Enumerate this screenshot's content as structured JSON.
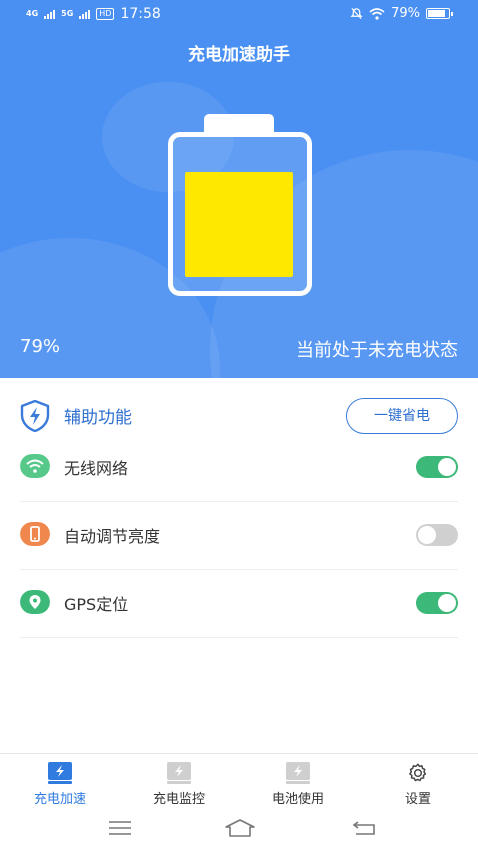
{
  "status_bar": {
    "net1": "4G",
    "net2": "5G",
    "hd": "HD",
    "time": "17:58",
    "battery_pct": "79%"
  },
  "header": {
    "title": "充电加速助手"
  },
  "battery": {
    "percent_label": "79%",
    "level": 0.79,
    "state": "当前处于未充电状态",
    "fill_color": "#ffe800"
  },
  "section": {
    "title": "辅助功能",
    "save_button": "一键省电"
  },
  "features": [
    {
      "label": "无线网络",
      "icon": "wifi-icon",
      "color": "#56c98a",
      "on": true
    },
    {
      "label": "自动调节亮度",
      "icon": "phone-icon",
      "color": "#f0874c",
      "on": false
    },
    {
      "label": "GPS定位",
      "icon": "location-icon",
      "color": "#3cb878",
      "on": true
    }
  ],
  "tabs": [
    {
      "label": "充电加速",
      "active": true
    },
    {
      "label": "充电监控",
      "active": false
    },
    {
      "label": "电池使用",
      "active": false
    },
    {
      "label": "设置",
      "active": false
    }
  ],
  "colors": {
    "primary": "#4a90f2",
    "accent_blue": "#2f7be0",
    "toggle_on": "#3cb878"
  }
}
